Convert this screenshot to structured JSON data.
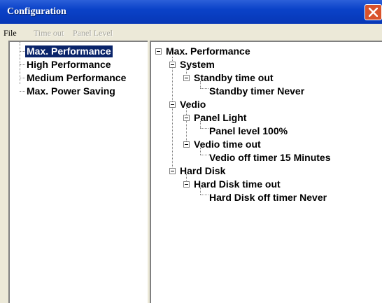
{
  "window": {
    "title": "Configuration"
  },
  "menu": {
    "items": [
      {
        "label": "File",
        "enabled": true
      },
      {
        "label": "Time out",
        "enabled": false
      },
      {
        "label": "Panel Level",
        "enabled": false
      }
    ]
  },
  "left_tree": {
    "items": [
      {
        "label": "Max. Performance",
        "selected": true
      },
      {
        "label": "High Performance",
        "selected": false
      },
      {
        "label": "Medium Performance",
        "selected": false
      },
      {
        "label": "Max. Power Saving",
        "selected": false
      }
    ]
  },
  "right_tree": {
    "root": "Max. Performance",
    "system": {
      "label": "System",
      "standby_label": "Standby time out",
      "standby_value": "Standby timer Never"
    },
    "vedio": {
      "label": "Vedio",
      "panel_light_label": "Panel Light",
      "panel_level_value": "Panel level 100%",
      "vedio_timeout_label": "Vedio time out",
      "vedio_timer_value": "Vedio off timer 15 Minutes"
    },
    "hard_disk": {
      "label": "Hard Disk",
      "timeout_label": "Hard Disk time out",
      "timer_value": "Hard Disk off timer Never"
    }
  },
  "colors": {
    "titlebar": "#0a42c8",
    "selection": "#0a246a",
    "close_button": "#d9532c"
  },
  "icons": {
    "close": "close-icon",
    "expander": "minus-box-icon"
  }
}
